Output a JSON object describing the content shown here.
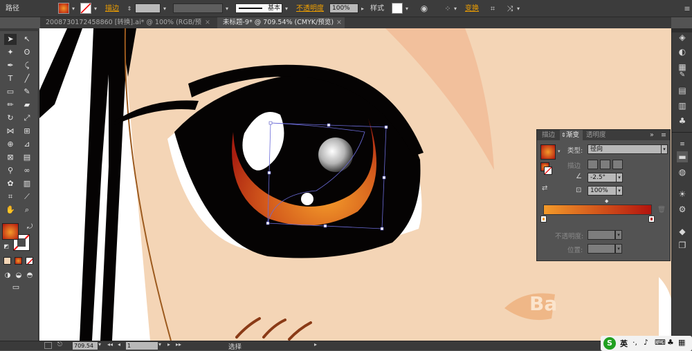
{
  "control_bar": {
    "object_type": "路径",
    "stroke_label": "描边",
    "stroke_profile": "基本",
    "opacity_label": "不透明度",
    "opacity_value": "100%",
    "style_label": "样式",
    "transform_label": "变换"
  },
  "tabs": [
    {
      "label": "20087301724588​60 [转换].ai* @ 100% (RGB/预览)",
      "active": false
    },
    {
      "label": "未标题-9* @ 709.54% (CMYK/预览)",
      "active": true
    }
  ],
  "tools": [
    "selection-tool",
    "direct-selection-tool",
    "magic-wand-tool",
    "lasso-tool",
    "pen-tool",
    "curvature-tool",
    "type-tool",
    "line-segment-tool",
    "rectangle-tool",
    "paintbrush-tool",
    "pencil-tool",
    "eraser-tool",
    "rotate-tool",
    "scale-tool",
    "width-tool",
    "free-transform-tool",
    "shape-builder-tool",
    "perspective-grid-tool",
    "mesh-tool",
    "gradient-tool",
    "eyedropper-tool",
    "blend-tool",
    "symbol-sprayer-tool",
    "column-graph-tool",
    "artboard-tool",
    "slice-tool",
    "hand-tool",
    "zoom-tool"
  ],
  "gradient_panel": {
    "tabs": [
      {
        "label": "描边",
        "active": false
      },
      {
        "label": "渐变",
        "active": true
      },
      {
        "label": "透明度",
        "active": false
      }
    ],
    "type_label": "类型:",
    "type_value": "径向",
    "stroke_label": "描边",
    "angle_value": "-2.5°",
    "ratio_value": "100%",
    "opacity_label": "不透明度:",
    "position_label": "位置:",
    "colors": {
      "start": "#f39a2a",
      "end": "#b3140e"
    }
  },
  "canvas": {
    "eye_colors": {
      "iris": "#050303",
      "highlight_orange": "#f0942e",
      "highlight_red": "#a81e10",
      "skin": "#f4d5b6"
    },
    "watermark": "Ba"
  },
  "status_bar": {
    "zoom": "709.54",
    "artboard": "1",
    "tool_name": "选择",
    "ime": "英"
  }
}
